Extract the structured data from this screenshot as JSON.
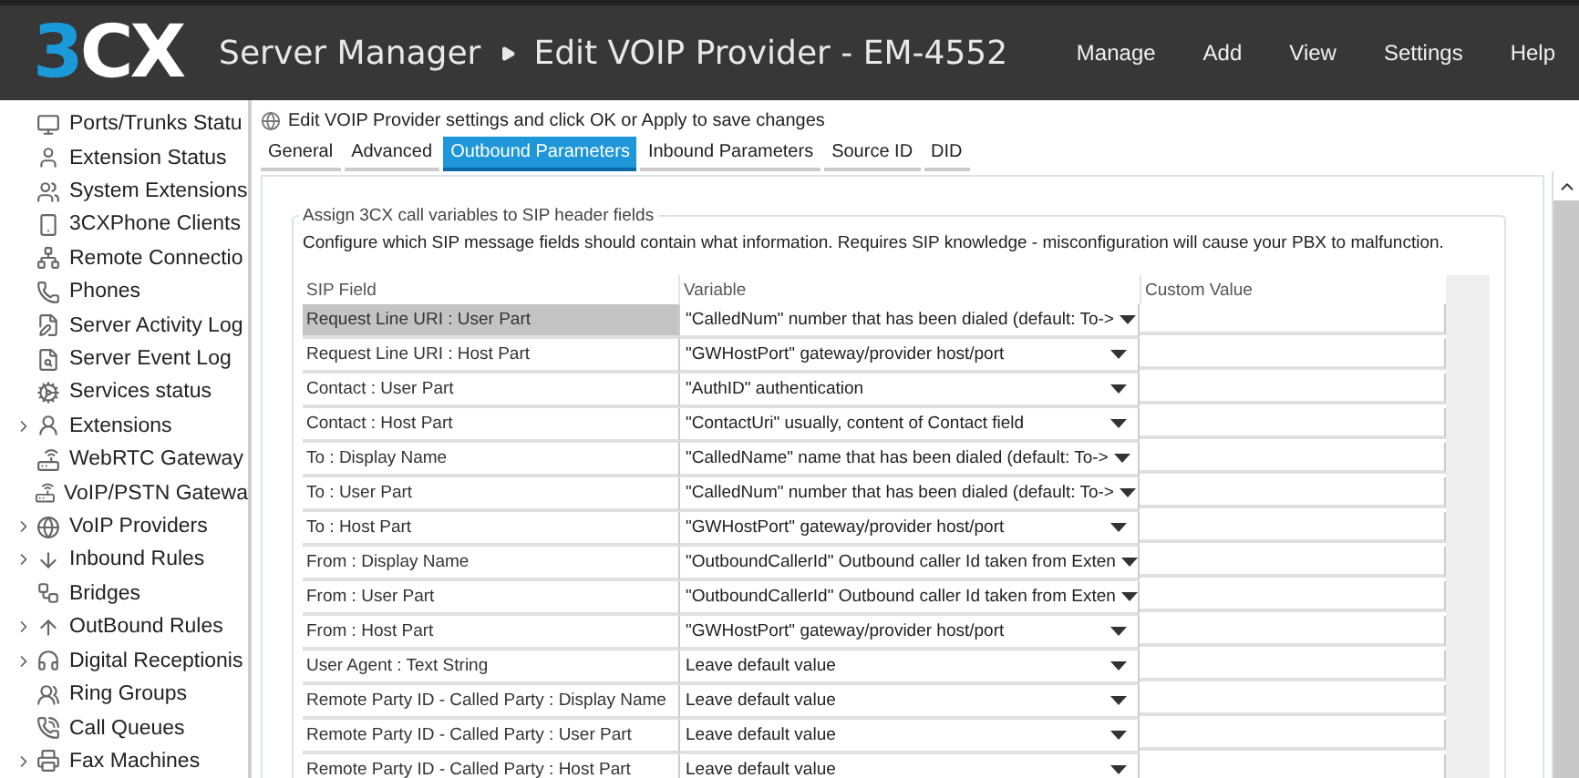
{
  "header": {
    "logo": {
      "digit": "3",
      "letters": "CX"
    },
    "breadcrumb": [
      "Server Manager",
      "Edit VOIP Provider - EM-4552"
    ],
    "menu": [
      "Manage",
      "Add",
      "View",
      "Settings",
      "Help"
    ]
  },
  "sidebar": {
    "items": [
      {
        "label": "Ports/Trunks Statu",
        "expandable": false
      },
      {
        "label": "Extension Status",
        "expandable": false
      },
      {
        "label": "System Extensions",
        "expandable": false
      },
      {
        "label": "3CXPhone Clients",
        "expandable": false
      },
      {
        "label": "Remote Connectio",
        "expandable": false
      },
      {
        "label": "Phones",
        "expandable": false
      },
      {
        "label": "Server Activity Log",
        "expandable": false
      },
      {
        "label": "Server Event Log",
        "expandable": false
      },
      {
        "label": "Services status",
        "expandable": false
      },
      {
        "label": "Extensions",
        "expandable": true
      },
      {
        "label": "WebRTC Gateway",
        "expandable": false
      },
      {
        "label": "VoIP/PSTN Gatewa",
        "expandable": false
      },
      {
        "label": "VoIP Providers",
        "expandable": true
      },
      {
        "label": "Inbound Rules",
        "expandable": true
      },
      {
        "label": "Bridges",
        "expandable": false
      },
      {
        "label": "OutBound Rules",
        "expandable": true
      },
      {
        "label": "Digital Receptionis",
        "expandable": true
      },
      {
        "label": "Ring Groups",
        "expandable": false
      },
      {
        "label": "Call Queues",
        "expandable": false
      },
      {
        "label": "Fax Machines",
        "expandable": true
      }
    ]
  },
  "instruction": "Edit VOIP Provider settings and click OK or Apply to save changes",
  "tabs": [
    {
      "label": "General",
      "selected": false
    },
    {
      "label": "Advanced",
      "selected": false
    },
    {
      "label": "Outbound Parameters",
      "selected": true
    },
    {
      "label": "Inbound Parameters",
      "selected": false
    },
    {
      "label": "Source ID",
      "selected": false
    },
    {
      "label": "DID",
      "selected": false
    }
  ],
  "group": {
    "title": "Assign 3CX call variables to SIP header fields",
    "description": "Configure which SIP message fields should contain what information. Requires SIP knowledge - misconfiguration will cause your PBX to malfunction."
  },
  "table": {
    "columns": [
      "SIP Field",
      "Variable",
      "Custom Value"
    ],
    "rows": [
      {
        "field": "Request Line URI : User Part",
        "variable": "\"CalledNum\" number that has been dialed (default: To->",
        "selected": true
      },
      {
        "field": "Request Line URI : Host Part",
        "variable": "\"GWHostPort\" gateway/provider host/port",
        "selected": false
      },
      {
        "field": "Contact : User Part",
        "variable": "\"AuthID\" authentication",
        "selected": false
      },
      {
        "field": "Contact : Host Part",
        "variable": "\"ContactUri\" usually, content of Contact field",
        "selected": false
      },
      {
        "field": "To : Display Name",
        "variable": "\"CalledName\" name that has been dialed (default: To->",
        "selected": false
      },
      {
        "field": "To : User Part",
        "variable": "\"CalledNum\" number that has been dialed (default: To->",
        "selected": false
      },
      {
        "field": "To : Host Part",
        "variable": "\"GWHostPort\" gateway/provider host/port",
        "selected": false
      },
      {
        "field": "From : Display Name",
        "variable": "\"OutboundCallerId\" Outbound caller Id taken from Exten",
        "selected": false
      },
      {
        "field": "From : User Part",
        "variable": "\"OutboundCallerId\" Outbound caller Id taken from Exten",
        "selected": false
      },
      {
        "field": "From : Host Part",
        "variable": "\"GWHostPort\" gateway/provider host/port",
        "selected": false
      },
      {
        "field": "User Agent : Text String",
        "variable": "Leave default value",
        "selected": false
      },
      {
        "field": "Remote Party ID - Called Party : Display Name",
        "variable": "Leave default value",
        "selected": false
      },
      {
        "field": "Remote Party ID - Called Party : User Part",
        "variable": "Leave default value",
        "selected": false
      },
      {
        "field": "Remote Party ID - Called Party : Host Part",
        "variable": "Leave default value",
        "selected": false
      }
    ]
  }
}
